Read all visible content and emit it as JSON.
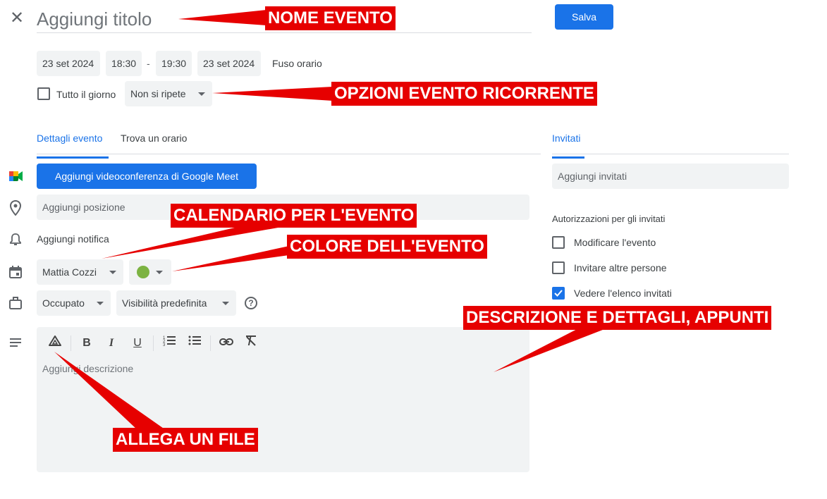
{
  "header": {
    "close_icon": "close-icon",
    "title_placeholder": "Aggiungi titolo",
    "save_label": "Salva"
  },
  "datetime": {
    "start_date": "23 set 2024",
    "start_time": "18:30",
    "separator": "-",
    "end_time": "19:30",
    "end_date": "23 set 2024",
    "timezone": "Fuso orario"
  },
  "options": {
    "all_day": "Tutto il giorno",
    "all_day_checked": false,
    "repeat": "Non si ripete"
  },
  "tabs": [
    {
      "label": "Dettagli evento",
      "active": true
    },
    {
      "label": "Trova un orario",
      "active": false
    }
  ],
  "details": {
    "meet_button": "Aggiungi videoconferenza di Google Meet",
    "location_placeholder": "Aggiungi posizione",
    "notification": "Aggiungi notifica",
    "calendar": "Mattia Cozzi",
    "event_color": "#7cb342",
    "status": "Occupato",
    "visibility": "Visibilità predefinita",
    "help_icon": "help-icon",
    "description_placeholder": "Aggiungi descrizione"
  },
  "toolbar_icons": [
    "drive-attach-icon",
    "bold-icon",
    "italic-icon",
    "underline-icon",
    "numbered-list-icon",
    "bulleted-list-icon",
    "link-icon",
    "clear-format-icon"
  ],
  "guests": {
    "tab_label": "Invitati",
    "add_placeholder": "Aggiungi invitati",
    "permissions_title": "Autorizzazioni per gli invitati",
    "permissions": [
      {
        "label": "Modificare l'evento",
        "checked": false
      },
      {
        "label": "Invitare altre persone",
        "checked": false
      },
      {
        "label": "Vedere l'elenco invitati",
        "checked": true
      }
    ]
  },
  "annotations": {
    "event_name": "NOME EVENTO",
    "recurring": "OPZIONI EVENTO RICORRENTE",
    "calendar": "CALENDARIO PER L'EVENTO",
    "color": "COLORE DELL'EVENTO",
    "description": "DESCRIZIONE E DETTAGLI, APPUNTI",
    "attach": "ALLEGA UN FILE"
  },
  "colors": {
    "accent": "#1a73e8",
    "annotation_red": "#e60000",
    "field_bg": "#f1f3f4"
  }
}
